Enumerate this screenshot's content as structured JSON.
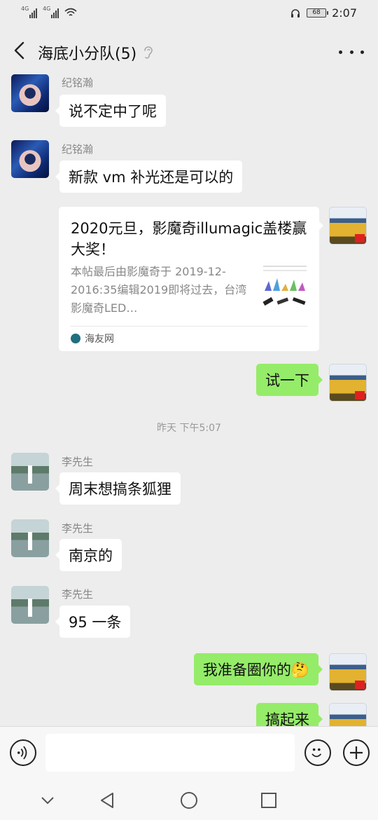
{
  "status_bar": {
    "network_1": "4G",
    "network_2": "4G",
    "battery": "68",
    "time": "2:07"
  },
  "header": {
    "title": "海底小分队(5)"
  },
  "messages": [
    {
      "sender": "纪铭瀚",
      "text": "说不定中了呢"
    },
    {
      "sender": "纪铭瀚",
      "text": "新款 vm 补光还是可以的"
    },
    {
      "text": "试一下"
    },
    {
      "sender": "李先生",
      "text": "周末想搞条狐狸"
    },
    {
      "sender": "李先生",
      "text": "南京的"
    },
    {
      "sender": "李先生",
      "text": "95 一条"
    },
    {
      "text": "我准备圈你的🤔"
    },
    {
      "text": "搞起来"
    }
  ],
  "link_card": {
    "title": "2020元旦，影魔奇illumagic盖楼赢大奖！",
    "description": "本帖最后由影魔奇于 2019-12-2016:35编辑2019即将过去，台湾影魔奇LED…",
    "source": "海友网"
  },
  "time_separator": "昨天 下午5:07",
  "icons": {
    "back": "chevron-left-icon",
    "ear": "ear-icon",
    "more": "more-icon",
    "voice": "voice-icon",
    "emoji": "emoji-icon",
    "plus": "plus-icon"
  }
}
